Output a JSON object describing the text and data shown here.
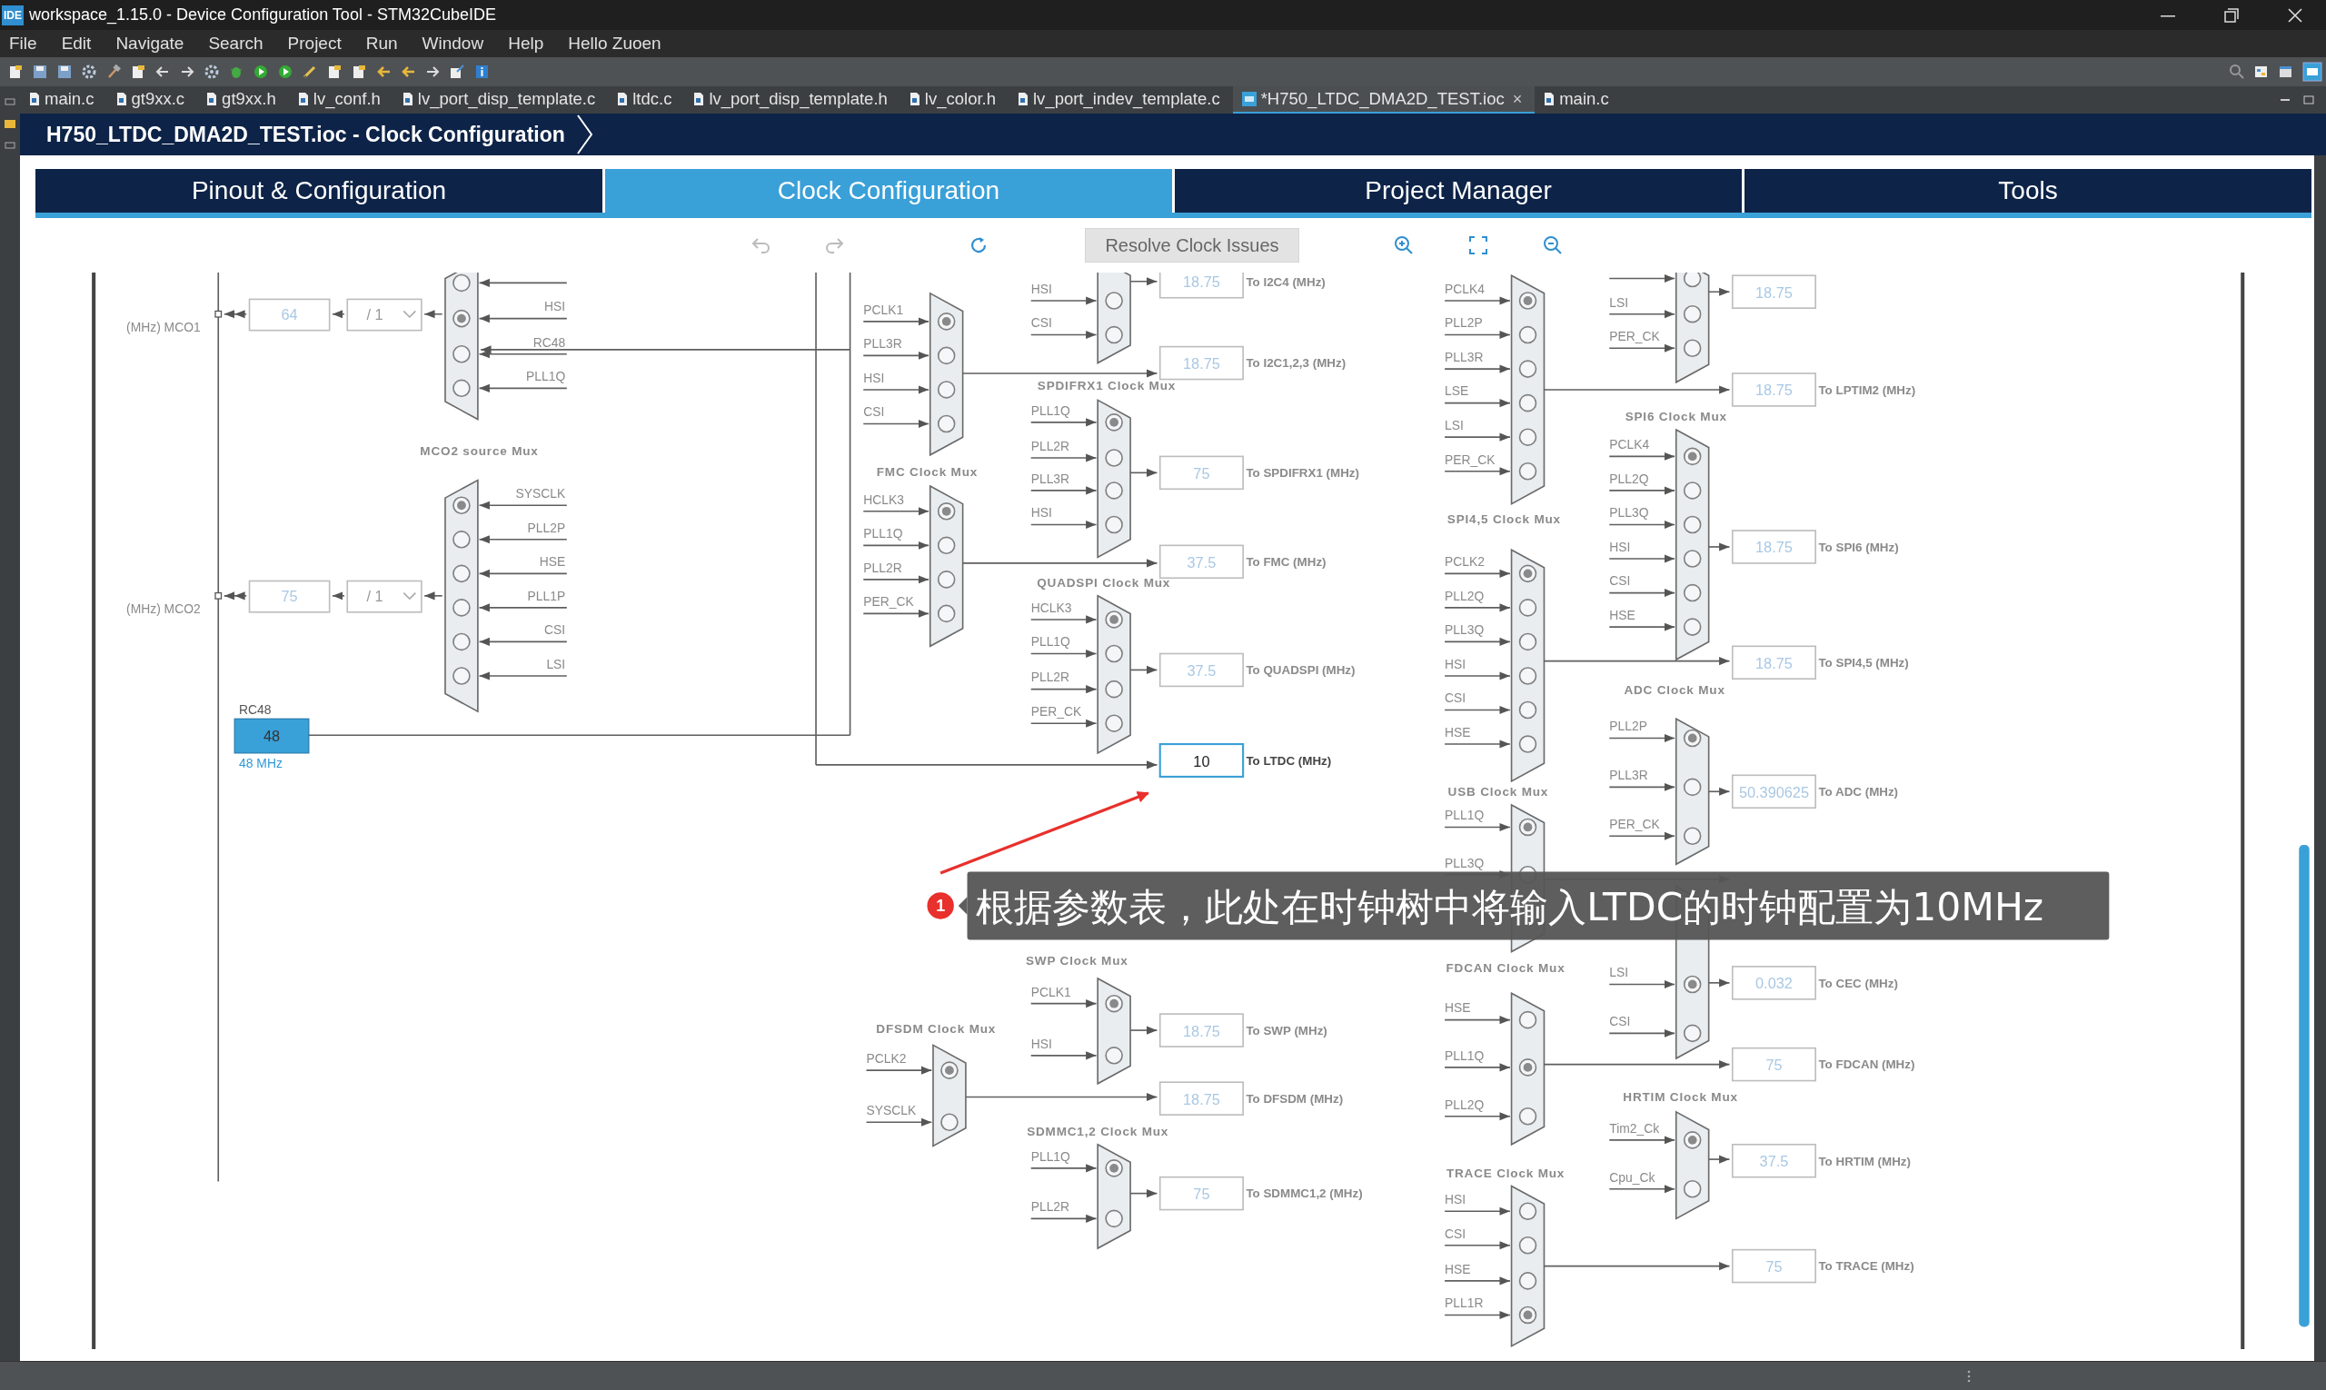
{
  "window": {
    "logo": "IDE",
    "title": "workspace_1.15.0 - Device Configuration Tool - STM32CubeIDE"
  },
  "menu": [
    "File",
    "Edit",
    "Navigate",
    "Search",
    "Project",
    "Run",
    "Window",
    "Help",
    "Hello Zuoen"
  ],
  "editor_tabs": [
    {
      "label": "main.c",
      "kind": "c",
      "selected": false
    },
    {
      "label": "gt9xx.c",
      "kind": "c",
      "selected": false
    },
    {
      "label": "gt9xx.h",
      "kind": "c",
      "selected": false
    },
    {
      "label": "lv_conf.h",
      "kind": "c",
      "selected": false
    },
    {
      "label": "lv_port_disp_template.c",
      "kind": "c",
      "selected": false
    },
    {
      "label": "ltdc.c",
      "kind": "c",
      "selected": false
    },
    {
      "label": "lv_port_disp_template.h",
      "kind": "c",
      "selected": false
    },
    {
      "label": "lv_color.h",
      "kind": "c",
      "selected": false
    },
    {
      "label": "lv_port_indev_template.c",
      "kind": "c",
      "selected": false
    },
    {
      "label": "*H750_LTDC_DMA2D_TEST.ioc",
      "kind": "mx",
      "selected": true,
      "close": "×"
    },
    {
      "label": "main.c",
      "kind": "c",
      "selected": false
    }
  ],
  "breadcrumb": "H750_LTDC_DMA2D_TEST.ioc - Clock Configuration",
  "config_tabs": [
    {
      "label": "Pinout & Configuration",
      "selected": false
    },
    {
      "label": "Clock Configuration",
      "selected": true
    },
    {
      "label": "Project Manager",
      "selected": false
    },
    {
      "label": "Tools",
      "selected": false
    }
  ],
  "resolve_button": "Resolve Clock Issues",
  "diagram": {
    "mco_outputs": [
      {
        "label": "(MHz) MCO1",
        "value": "64",
        "divider": "/ 1"
      },
      {
        "label": "(MHz) MCO2",
        "value": "75",
        "divider": "/ 1"
      }
    ],
    "sources": [
      {
        "name": "RC48",
        "value": "48",
        "frequency": "48 MHz"
      }
    ],
    "muxes": [
      {
        "inputs": [
          {
            "selected": false
          },
          {
            "label": "HSI",
            "selected": true
          },
          {
            "label": "RC48",
            "selected": false
          },
          {
            "label": "PLL1Q",
            "selected": false
          }
        ]
      },
      {
        "title": "MCO2 source Mux",
        "inputs": [
          {
            "label": "SYSCLK",
            "selected": true
          },
          {
            "label": "PLL2P",
            "selected": false
          },
          {
            "label": "HSE",
            "selected": false
          },
          {
            "label": "PLL1P",
            "selected": false
          },
          {
            "label": "CSI",
            "selected": false
          },
          {
            "label": "LSI",
            "selected": false
          }
        ]
      },
      {
        "inputs": [
          {
            "label": "HSI",
            "selected": false
          },
          {
            "label": "CSI",
            "selected": false
          }
        ]
      },
      {
        "inputs": [
          {
            "label": "PCLK1",
            "selected": true
          },
          {
            "label": "PLL3R",
            "selected": false
          },
          {
            "label": "HSI",
            "selected": false
          },
          {
            "label": "CSI",
            "selected": false
          }
        ]
      },
      {
        "title": "SPDIFRX1 Clock Mux",
        "inputs": [
          {
            "label": "PLL1Q",
            "selected": true
          },
          {
            "label": "PLL2R",
            "selected": false
          },
          {
            "label": "PLL3R",
            "selected": false
          },
          {
            "label": "HSI",
            "selected": false
          }
        ]
      },
      {
        "title": "FMC Clock Mux",
        "inputs": [
          {
            "label": "HCLK3",
            "selected": true
          },
          {
            "label": "PLL1Q",
            "selected": false
          },
          {
            "label": "PLL2R",
            "selected": false
          },
          {
            "label": "PER_CK",
            "selected": false
          }
        ]
      },
      {
        "title": "QUADSPI Clock Mux",
        "inputs": [
          {
            "label": "HCLK3",
            "selected": true
          },
          {
            "label": "PLL1Q",
            "selected": false
          },
          {
            "label": "PLL2R",
            "selected": false
          },
          {
            "label": "PER_CK",
            "selected": false
          }
        ]
      },
      {
        "title": "SWP Clock Mux",
        "inputs": [
          {
            "label": "PCLK1",
            "selected": true
          },
          {
            "label": "HSI",
            "selected": false
          }
        ]
      },
      {
        "title": "DFSDM Clock Mux",
        "inputs": [
          {
            "label": "PCLK2",
            "selected": true
          },
          {
            "label": "SYSCLK",
            "selected": false
          }
        ]
      },
      {
        "title": "SDMMC1,2 Clock Mux",
        "inputs": [
          {
            "label": "PLL1Q",
            "selected": true
          },
          {
            "label": "PLL2R",
            "selected": false
          }
        ]
      },
      {
        "inputs": [
          {
            "label": "PCLK4",
            "selected": true
          },
          {
            "label": "PLL2P",
            "selected": false
          },
          {
            "label": "PLL3R",
            "selected": false
          },
          {
            "label": "LSE",
            "selected": false
          },
          {
            "label": "LSI",
            "selected": false
          },
          {
            "label": "PER_CK",
            "selected": false
          }
        ]
      },
      {
        "inputs": [
          {
            "selected": false
          },
          {
            "label": "LSI",
            "selected": false
          },
          {
            "label": "PER_CK",
            "selected": false
          }
        ]
      },
      {
        "title": "SPI4,5 Clock Mux",
        "inputs": [
          {
            "label": "PCLK2",
            "selected": true
          },
          {
            "label": "PLL2Q",
            "selected": false
          },
          {
            "label": "PLL3Q",
            "selected": false
          },
          {
            "label": "HSI",
            "selected": false
          },
          {
            "label": "CSI",
            "selected": false
          },
          {
            "label": "HSE",
            "selected": false
          }
        ]
      },
      {
        "title": "SPI6 Clock Mux",
        "inputs": [
          {
            "label": "PCLK4",
            "selected": true
          },
          {
            "label": "PLL2Q",
            "selected": false
          },
          {
            "label": "PLL3Q",
            "selected": false
          },
          {
            "label": "HSI",
            "selected": false
          },
          {
            "label": "CSI",
            "selected": false
          },
          {
            "label": "HSE",
            "selected": false
          }
        ]
      },
      {
        "title": "ADC Clock Mux",
        "inputs": [
          {
            "label": "PLL2P",
            "selected": true
          },
          {
            "label": "PLL3R",
            "selected": false
          },
          {
            "label": "PER_CK",
            "selected": false
          }
        ]
      },
      {
        "title": "USB Clock Mux",
        "inputs": [
          {
            "label": "PLL1Q",
            "selected": true
          },
          {
            "label": "PLL3Q",
            "selected": false
          }
        ]
      },
      {
        "title": "FDCAN Clock Mux",
        "inputs": [
          {
            "label": "HSE",
            "selected": false
          },
          {
            "label": "PLL1Q",
            "selected": true
          },
          {
            "label": "PLL2Q",
            "selected": false
          }
        ]
      },
      {
        "inputs": [
          {
            "label": "LSI",
            "selected": true
          },
          {
            "label": "CSI",
            "selected": false
          }
        ]
      },
      {
        "title": "HRTIM Clock Mux",
        "inputs": [
          {
            "label": "Tim2_Ck",
            "selected": true
          },
          {
            "label": "Cpu_Ck",
            "selected": false
          }
        ]
      },
      {
        "title": "TRACE Clock Mux",
        "inputs": [
          {
            "label": "HSI",
            "selected": false
          },
          {
            "label": "CSI",
            "selected": false
          },
          {
            "label": "HSE",
            "selected": false
          },
          {
            "label": "PLL1R",
            "selected": true
          }
        ]
      }
    ],
    "outputs": [
      {
        "value": "18.75",
        "label": "To I2C4 (MHz)",
        "active": false
      },
      {
        "value": "18.75",
        "label": "To I2C1,2,3 (MHz)",
        "active": false
      },
      {
        "value": "75",
        "label": "To SPDIFRX1 (MHz)",
        "active": false
      },
      {
        "value": "37.5",
        "label": "To FMC (MHz)",
        "active": false
      },
      {
        "value": "37.5",
        "label": "To QUADSPI (MHz)",
        "active": false
      },
      {
        "value": "10",
        "label": "To LTDC (MHz)",
        "active": true
      },
      {
        "value": "18.75",
        "label": "To SWP (MHz)",
        "active": false
      },
      {
        "value": "18.75",
        "label": "To DFSDM (MHz)",
        "active": false
      },
      {
        "value": "75",
        "label": "To SDMMC1,2 (MHz)",
        "active": false
      },
      {
        "value": "18.75",
        "active": false
      },
      {
        "value": "18.75",
        "label": "To LPTIM2 (MHz)",
        "active": false
      },
      {
        "value": "18.75",
        "label": "To SPI6 (MHz)",
        "active": false
      },
      {
        "value": "18.75",
        "label": "To SPI4,5 (MHz)",
        "active": false
      },
      {
        "value": "50.390625",
        "label": "To ADC (MHz)",
        "active": false
      },
      {
        "value": "0.032",
        "label": "To CEC (MHz)",
        "active": false
      },
      {
        "value": "75",
        "label": "To FDCAN (MHz)",
        "active": false
      },
      {
        "value": "37.5",
        "label": "To HRTIM (MHz)",
        "active": false
      },
      {
        "value": "75",
        "label": "To TRACE (MHz)",
        "active": false
      }
    ]
  },
  "annotation": {
    "number": "1",
    "text": "根据参数表，此处在时钟树中将输入LTDC的时钟配置为10MHz"
  }
}
